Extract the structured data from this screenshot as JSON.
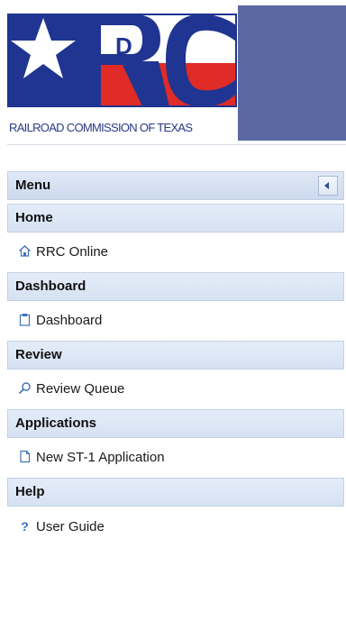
{
  "logo": {
    "text": "RAILROAD COMMISSION OF TEXAS",
    "letters": "RRC",
    "accent_letter": "D",
    "colors": {
      "blue": "#1f3591",
      "red": "#e02b27",
      "banner": "#5b68a2"
    }
  },
  "menu": {
    "title": "Menu",
    "collapse_icon": "triangle-left-icon",
    "sections": [
      {
        "heading": "Home",
        "items": [
          {
            "label": "RRC Online",
            "icon": "home-icon"
          }
        ]
      },
      {
        "heading": "Dashboard",
        "items": [
          {
            "label": "Dashboard",
            "icon": "clipboard-icon"
          }
        ]
      },
      {
        "heading": "Review",
        "items": [
          {
            "label": "Review Queue",
            "icon": "search-icon"
          }
        ]
      },
      {
        "heading": "Applications",
        "items": [
          {
            "label": "New ST-1 Application",
            "icon": "document-icon"
          }
        ]
      },
      {
        "heading": "Help",
        "items": [
          {
            "label": "User Guide",
            "icon": "help-icon",
            "glyph": "?"
          }
        ]
      }
    ]
  }
}
